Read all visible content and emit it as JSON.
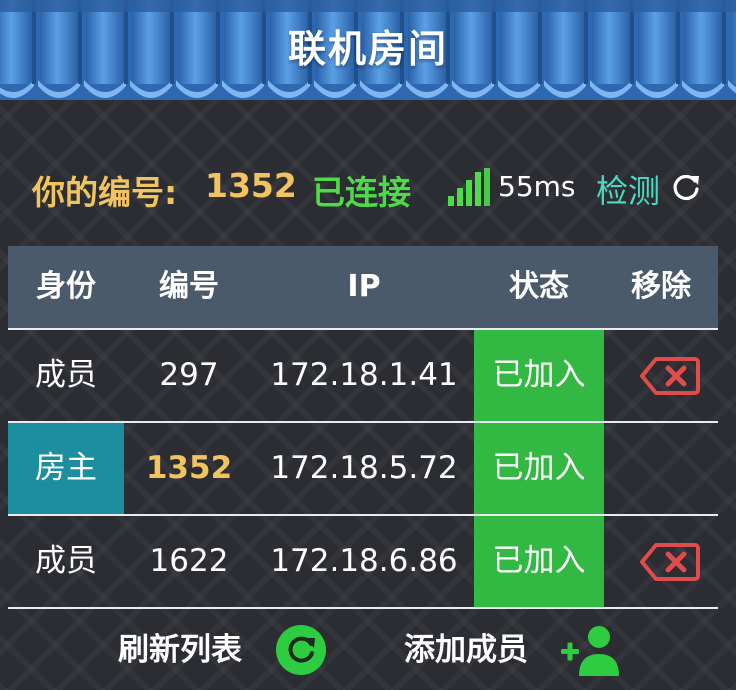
{
  "header": {
    "title": "联机房间",
    "colors": {
      "tile": "#2f6fb9",
      "tile_light": "#5a9be0",
      "edge": "#7fb6ef"
    }
  },
  "status": {
    "my_id_label": "你的编号:",
    "my_id": "1352",
    "connection": "已连接",
    "signal_icon": "signal-bars-icon",
    "signal_bars": 4,
    "ping": "55ms",
    "check_label": "检测",
    "check_icon": "refresh-icon",
    "colors": {
      "id": "#f2c460",
      "connected": "#4ddc48",
      "check": "#4cd9c4"
    }
  },
  "table": {
    "headers": [
      "身份",
      "编号",
      "IP",
      "状态",
      "移除"
    ],
    "rows": [
      {
        "role": "成员",
        "id": "297",
        "ip": "172.18.1.41",
        "state": "已加入",
        "removable": true
      },
      {
        "role": "房主",
        "id": "1352",
        "ip": "172.18.5.72",
        "state": "已加入",
        "removable": false
      },
      {
        "role": "成员",
        "id": "1622",
        "ip": "172.18.6.86",
        "state": "已加入",
        "removable": true
      }
    ],
    "remove_icon": "delete-backspace-icon",
    "colors": {
      "header_bg": "#4b5a6b",
      "joined": "#33b844",
      "host": "#1d8ea0",
      "remove": "#e04b4b"
    }
  },
  "footer": {
    "refresh_label": "刷新列表",
    "refresh_icon": "refresh-circle-icon",
    "add_label": "添加成员",
    "add_icon": "add-person-icon",
    "colors": {
      "icon": "#2ecc40"
    }
  }
}
